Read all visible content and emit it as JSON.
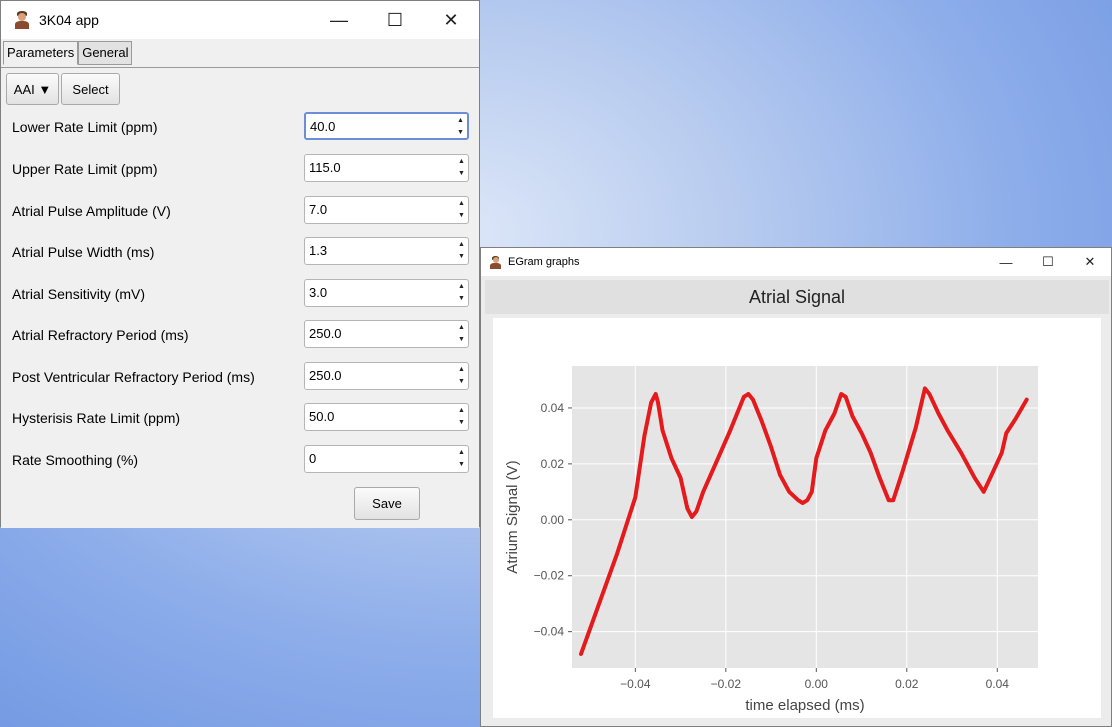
{
  "main_window": {
    "title": "3K04 app",
    "controls": {
      "minimize": "—",
      "maximize": "☐",
      "close": "✕"
    },
    "tabs": [
      {
        "label": "Parameters",
        "active": true
      },
      {
        "label": "General",
        "active": false
      }
    ],
    "mode_dropdown": "AAI ▼",
    "select_label": "Select",
    "parameters": [
      {
        "label": "Lower Rate Limit (ppm)",
        "value": "40.0"
      },
      {
        "label": "Upper Rate Limit (ppm)",
        "value": "115.0"
      },
      {
        "label": "Atrial Pulse Amplitude (V)",
        "value": "7.0"
      },
      {
        "label": "Atrial Pulse Width (ms)",
        "value": "1.3"
      },
      {
        "label": "Atrial Sensitivity (mV)",
        "value": "3.0"
      },
      {
        "label": "Atrial Refractory Period (ms)",
        "value": "250.0"
      },
      {
        "label": "Post Ventricular Refractory Period (ms)",
        "value": "250.0"
      },
      {
        "label": "Hysterisis Rate Limit (ppm)",
        "value": "50.0"
      },
      {
        "label": "Rate Smoothing (%)",
        "value": "0"
      }
    ],
    "save_label": "Save"
  },
  "graph_window": {
    "title": "EGram graphs",
    "controls": {
      "minimize": "—",
      "maximize": "☐",
      "close": "✕"
    },
    "chart_title": "Atrial Signal"
  },
  "chart_data": {
    "type": "line",
    "title": "Atrial Signal",
    "xlabel": "time elapsed (ms)",
    "ylabel": "Atrium Signal (V)",
    "xlim": [
      -0.054,
      0.049
    ],
    "ylim": [
      -0.053,
      0.055
    ],
    "xticks": [
      "−0.04",
      "−0.02",
      "0.00",
      "0.02",
      "0.04"
    ],
    "xtick_values": [
      -0.04,
      -0.02,
      0.0,
      0.02,
      0.04
    ],
    "yticks": [
      "−0.04",
      "−0.02",
      "0.00",
      "0.02",
      "0.04"
    ],
    "ytick_values": [
      -0.04,
      -0.02,
      0.0,
      0.02,
      0.04
    ],
    "grid": true,
    "line_color": "#e41a1c",
    "series": [
      {
        "x": [
          -0.052,
          -0.048,
          -0.044,
          -0.04,
          -0.038,
          -0.0365,
          -0.0355,
          -0.035,
          -0.034,
          -0.032,
          -0.03,
          -0.0285,
          -0.0275,
          -0.0265,
          -0.025,
          -0.022,
          -0.019,
          -0.016,
          -0.015,
          -0.014,
          -0.012,
          -0.01,
          -0.008,
          -0.006,
          -0.004,
          -0.003,
          -0.002,
          -0.001,
          0.0,
          0.002,
          0.004,
          0.0055,
          0.0065,
          0.008,
          0.01,
          0.012,
          0.014,
          0.016,
          0.017,
          0.019,
          0.022,
          0.024,
          0.025,
          0.027,
          0.029,
          0.032,
          0.035,
          0.037,
          0.039,
          0.041,
          0.042,
          0.044,
          0.0465
        ],
        "y": [
          -0.048,
          -0.03,
          -0.012,
          0.008,
          0.03,
          0.042,
          0.045,
          0.042,
          0.032,
          0.022,
          0.015,
          0.004,
          0.001,
          0.003,
          0.01,
          0.021,
          0.032,
          0.044,
          0.045,
          0.043,
          0.035,
          0.026,
          0.016,
          0.01,
          0.007,
          0.006,
          0.007,
          0.01,
          0.022,
          0.032,
          0.038,
          0.045,
          0.044,
          0.037,
          0.031,
          0.024,
          0.015,
          0.007,
          0.007,
          0.017,
          0.033,
          0.047,
          0.045,
          0.038,
          0.032,
          0.024,
          0.015,
          0.01,
          0.017,
          0.024,
          0.031,
          0.036,
          0.043
        ]
      }
    ]
  }
}
